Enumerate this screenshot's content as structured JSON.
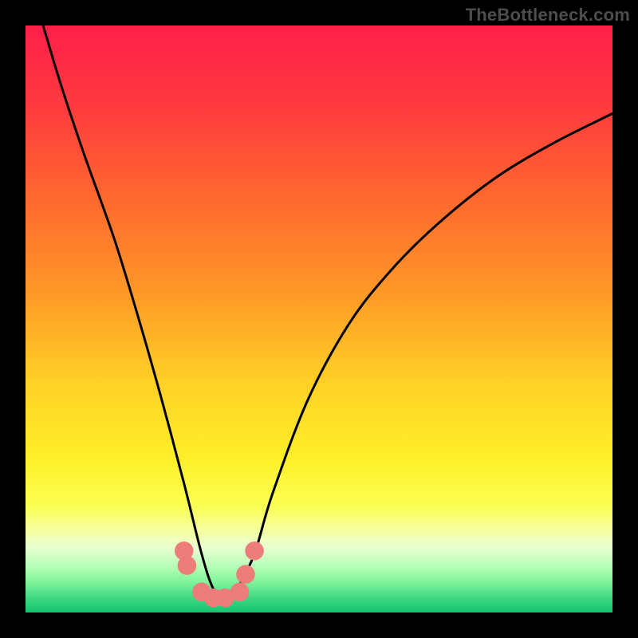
{
  "watermark": "TheBottleneck.com",
  "chart_data": {
    "type": "line",
    "title": "",
    "xlabel": "",
    "ylabel": "",
    "xlim": [
      0,
      100
    ],
    "ylim": [
      0,
      100
    ],
    "curve": {
      "name": "bottleneck-curve",
      "x": [
        3,
        6,
        10,
        15,
        19,
        23,
        27,
        30,
        32,
        34,
        36,
        39,
        42,
        48,
        55,
        62,
        70,
        80,
        90,
        100
      ],
      "y": [
        100,
        90,
        78,
        64,
        51,
        37,
        22,
        10,
        4,
        2,
        4,
        10,
        20,
        36,
        49,
        58,
        66,
        74,
        80,
        85
      ]
    },
    "markers": {
      "name": "bottleneck-markers",
      "color": "#ed7d79",
      "radius": 1.6,
      "x": [
        27,
        27.5,
        30,
        32,
        34,
        36.5,
        37.5,
        39
      ],
      "y": [
        10.5,
        8,
        3.5,
        2.5,
        2.5,
        3.5,
        6.5,
        10.5
      ]
    },
    "gradient_stops": [
      {
        "offset": 0.0,
        "color": "#ff1f4a"
      },
      {
        "offset": 0.14,
        "color": "#ff3b3e"
      },
      {
        "offset": 0.3,
        "color": "#ff6a2e"
      },
      {
        "offset": 0.45,
        "color": "#ff9627"
      },
      {
        "offset": 0.6,
        "color": "#ffce26"
      },
      {
        "offset": 0.74,
        "color": "#fff029"
      },
      {
        "offset": 0.82,
        "color": "#fbff55"
      },
      {
        "offset": 0.86,
        "color": "#f5ffa0"
      },
      {
        "offset": 0.89,
        "color": "#e9ffd2"
      },
      {
        "offset": 0.92,
        "color": "#b8ffb8"
      },
      {
        "offset": 0.95,
        "color": "#7cf29a"
      },
      {
        "offset": 0.98,
        "color": "#34d47e"
      },
      {
        "offset": 1.0,
        "color": "#14c470"
      }
    ]
  }
}
